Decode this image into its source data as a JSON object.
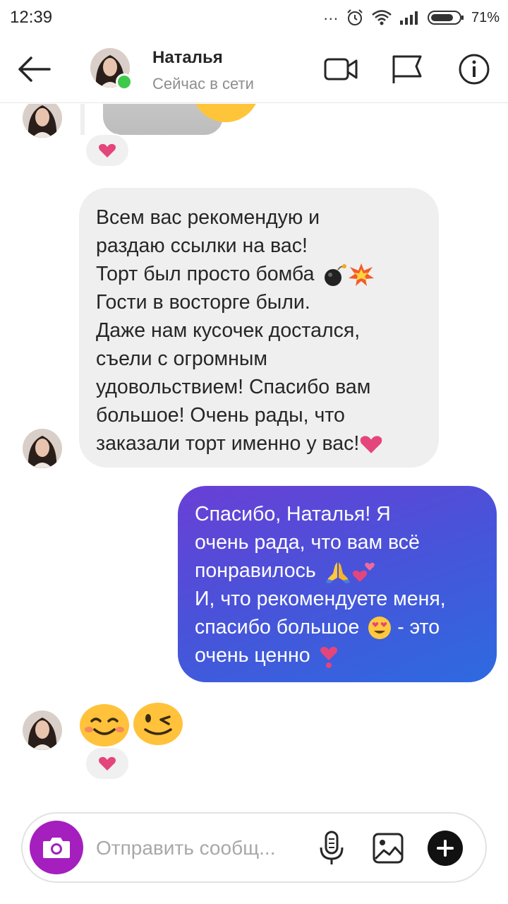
{
  "status_bar": {
    "time": "12:39",
    "more": "...",
    "battery_percent": "71%"
  },
  "header": {
    "contact_name": "Наталья",
    "contact_status": "Сейчас в сети",
    "online_color": "#3ec94b"
  },
  "icons": {
    "back": "arrow-left-icon",
    "video": "video-camera-icon",
    "flag": "flag-icon",
    "info": "info-icon",
    "camera": "camera-icon",
    "mic": "microphone-icon",
    "gallery": "image-icon",
    "plus": "plus-icon"
  },
  "messages": [
    {
      "from": "contact",
      "type": "image",
      "reaction": "heart"
    },
    {
      "from": "contact",
      "type": "text",
      "lines": [
        "Всем вас рекомендую и",
        "раздаю ссылки на вас!",
        "Торт был просто бомба",
        "Гости в восторге были.",
        "Даже нам кусочек достался,",
        "съели с огромным",
        "удовольствием! Спасибо вам",
        "большое! Очень рады, что",
        "заказали торт именно у вас!"
      ],
      "emoji": [
        "bomb",
        "collision",
        "heart"
      ]
    },
    {
      "from": "me",
      "type": "text",
      "lines": [
        "Спасибо, Наталья! Я",
        "очень рада, что вам всё",
        "понравилось",
        "И, что рекомендуете меня,",
        "спасибо большое",
        "- это",
        "очень ценно"
      ],
      "emoji": [
        "folded-hands",
        "two-hearts",
        "smiling-face-heart-eyes",
        "heart-exclamation"
      ]
    },
    {
      "from": "contact",
      "type": "emoji",
      "emoji": [
        "smiling-face-smiling-eyes",
        "winking-face"
      ],
      "reaction": "heart"
    }
  ],
  "composer": {
    "placeholder": "Отправить сообщ..."
  },
  "colors": {
    "outgoing_gradient_start": "#6a3fd6",
    "outgoing_gradient_end": "#2d6ae0",
    "incoming_bubble": "#efefef",
    "camera_button": "#a41fbe",
    "reaction_heart": "#e4457a"
  }
}
